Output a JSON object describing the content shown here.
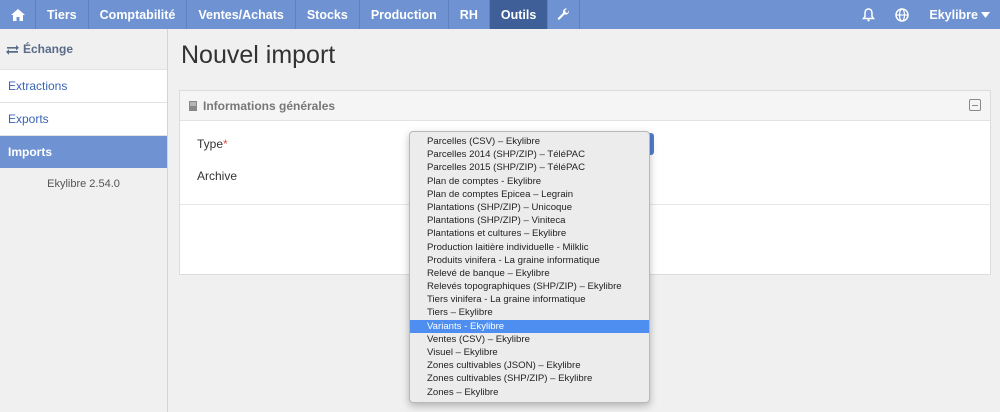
{
  "topbar": {
    "items": [
      "Tiers",
      "Comptabilité",
      "Ventes/Achats",
      "Stocks",
      "Production",
      "RH",
      "Outils"
    ],
    "active": "Outils",
    "user": "Ekylibre",
    "icons": [
      "home-icon",
      "wrench-icon",
      "bell-icon",
      "globe-icon",
      "caret-down-icon"
    ],
    "accent_color": "#6f93d2",
    "active_color": "#3e5f98"
  },
  "sidebar": {
    "section": "Échange",
    "items": [
      {
        "label": "Extractions",
        "active": false
      },
      {
        "label": "Exports",
        "active": false
      },
      {
        "label": "Imports",
        "active": true
      }
    ],
    "version": "Ekylibre 2.54.0"
  },
  "main": {
    "title": "Nouvel import",
    "panel_title": "Informations générales",
    "fields": {
      "type_label": "Type",
      "required_mark": "*",
      "archive_label": "Archive"
    }
  },
  "dropdown": {
    "options": [
      "Parcelles (CSV) – Ekylibre",
      "Parcelles 2014 (SHP/ZIP) – TéléPAC",
      "Parcelles 2015 (SHP/ZIP) – TéléPAC",
      "Plan de comptes - Ekylibre",
      "Plan de comptes Epicea – Legrain",
      "Plantations (SHP/ZIP) – Unicoque",
      "Plantations (SHP/ZIP) – Viniteca",
      "Plantations et cultures – Ekylibre",
      "Production laitière individuelle - Milklic",
      "Produits vinifera - La graine informatique",
      "Relevé de banque – Ekylibre",
      "Relevés topographiques (SHP/ZIP) – Ekylibre",
      "Tiers vinifera - La graine informatique",
      "Tiers – Ekylibre",
      "Variants - Ekylibre",
      "Ventes (CSV) – Ekylibre",
      "Visuel – Ekylibre",
      "Zones cultivables (JSON) – Ekylibre",
      "Zones cultivables (SHP/ZIP) – Ekylibre",
      "Zones – Ekylibre"
    ],
    "selected_index": 14,
    "selected_color": "#4d8ef0"
  }
}
